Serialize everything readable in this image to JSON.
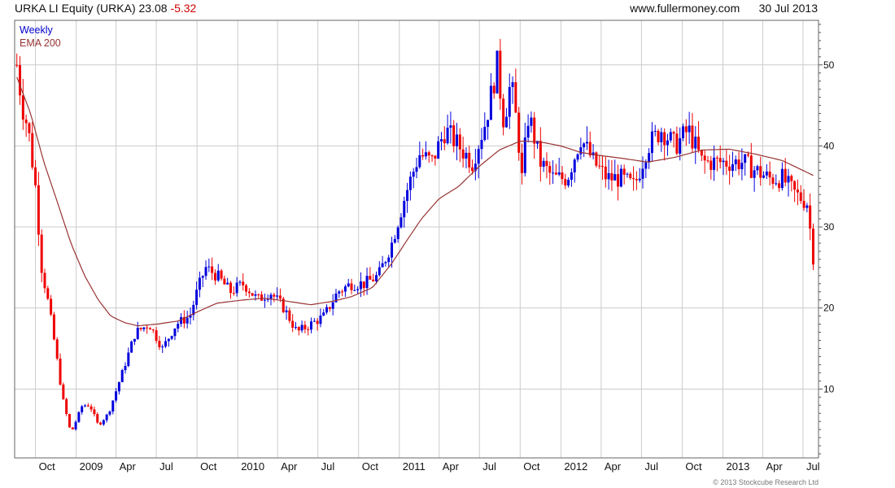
{
  "header": {
    "symbol": "URKA LI Equity (URKA)",
    "price": "23.08",
    "change": "-5.32",
    "website": "www.fullermoney.com",
    "date": "30 Jul 2013"
  },
  "legend": {
    "frequency": "Weekly",
    "ema": "EMA 200"
  },
  "copyright": "© 2013 Stockcube Research Ltd",
  "colors": {
    "up": "#0000dd",
    "down": "#ee0000",
    "ema": "#993333",
    "grid": "#cccccc",
    "frame": "#666666"
  },
  "chart_data": {
    "type": "candlestick",
    "frequency": "Weekly",
    "y_axis": {
      "position": "right",
      "ticks": [
        10,
        20,
        30,
        40,
        50
      ],
      "range": [
        1.5,
        55.5
      ]
    },
    "x_ticks": [
      {
        "label": "Oct",
        "date": "2008-10"
      },
      {
        "label": "2009",
        "date": "2009-01"
      },
      {
        "label": "Apr",
        "date": "2009-04"
      },
      {
        "label": "Jul",
        "date": "2009-07"
      },
      {
        "label": "Oct",
        "date": "2009-10"
      },
      {
        "label": "2010",
        "date": "2010-01"
      },
      {
        "label": "Apr",
        "date": "2010-04"
      },
      {
        "label": "Jul",
        "date": "2010-07"
      },
      {
        "label": "Oct",
        "date": "2010-10"
      },
      {
        "label": "2011",
        "date": "2011-01"
      },
      {
        "label": "Apr",
        "date": "2011-04"
      },
      {
        "label": "Jul",
        "date": "2011-07"
      },
      {
        "label": "Oct",
        "date": "2011-10"
      },
      {
        "label": "2012",
        "date": "2012-01"
      },
      {
        "label": "Apr",
        "date": "2012-04"
      },
      {
        "label": "Jul",
        "date": "2012-07"
      },
      {
        "label": "Oct",
        "date": "2012-10"
      },
      {
        "label": "2013",
        "date": "2013-01"
      },
      {
        "label": "Apr",
        "date": "2013-04"
      },
      {
        "label": "Jul",
        "date": "2013-07"
      }
    ],
    "price_anchors": [
      [
        "2008-08-20",
        50
      ],
      [
        "2008-09-01",
        45
      ],
      [
        "2008-09-15",
        42
      ],
      [
        "2008-10-01",
        35
      ],
      [
        "2008-10-15",
        25
      ],
      [
        "2008-11-01",
        20
      ],
      [
        "2008-11-15",
        15
      ],
      [
        "2008-12-01",
        9
      ],
      [
        "2008-12-20",
        4.5
      ],
      [
        "2009-01-15",
        8
      ],
      [
        "2009-02-01",
        8
      ],
      [
        "2009-02-20",
        5.5
      ],
      [
        "2009-03-15",
        7
      ],
      [
        "2009-04-15",
        12
      ],
      [
        "2009-05-15",
        17
      ],
      [
        "2009-06-15",
        18
      ],
      [
        "2009-07-15",
        15
      ],
      [
        "2009-08-15",
        18
      ],
      [
        "2009-09-15",
        19
      ],
      [
        "2009-10-01",
        22
      ],
      [
        "2009-10-20",
        25
      ],
      [
        "2009-11-15",
        24
      ],
      [
        "2009-12-15",
        22
      ],
      [
        "2010-01-15",
        23
      ],
      [
        "2010-02-15",
        21
      ],
      [
        "2010-03-15",
        22
      ],
      [
        "2010-04-15",
        20
      ],
      [
        "2010-05-15",
        17
      ],
      [
        "2010-06-15",
        18
      ],
      [
        "2010-07-15",
        19
      ],
      [
        "2010-08-15",
        22
      ],
      [
        "2010-09-15",
        23
      ],
      [
        "2010-10-15",
        23
      ],
      [
        "2010-11-15",
        24
      ],
      [
        "2010-12-15",
        28
      ],
      [
        "2011-01-15",
        34
      ],
      [
        "2011-02-15",
        39
      ],
      [
        "2011-03-15",
        38
      ],
      [
        "2011-04-15",
        42
      ],
      [
        "2011-05-15",
        40
      ],
      [
        "2011-06-15",
        38
      ],
      [
        "2011-07-15",
        43
      ],
      [
        "2011-08-10",
        50
      ],
      [
        "2011-08-25",
        43
      ],
      [
        "2011-09-10",
        48
      ],
      [
        "2011-09-25",
        42
      ],
      [
        "2011-10-05",
        36
      ],
      [
        "2011-10-20",
        44
      ],
      [
        "2011-11-15",
        38
      ],
      [
        "2011-12-15",
        36
      ],
      [
        "2012-01-15",
        36
      ],
      [
        "2012-02-15",
        41
      ],
      [
        "2012-03-15",
        38
      ],
      [
        "2012-04-15",
        36
      ],
      [
        "2012-05-15",
        36
      ],
      [
        "2012-06-15",
        35
      ],
      [
        "2012-07-15",
        40
      ],
      [
        "2012-08-15",
        42
      ],
      [
        "2012-09-15",
        40
      ],
      [
        "2012-10-15",
        42
      ],
      [
        "2012-11-15",
        38
      ],
      [
        "2012-12-15",
        38
      ],
      [
        "2013-01-15",
        38
      ],
      [
        "2013-02-15",
        38
      ],
      [
        "2013-03-15",
        37
      ],
      [
        "2013-04-15",
        36
      ],
      [
        "2013-05-15",
        36
      ],
      [
        "2013-06-15",
        34
      ],
      [
        "2013-07-10",
        33
      ],
      [
        "2013-07-20",
        28.4
      ],
      [
        "2013-07-30",
        23.08
      ]
    ],
    "ema_anchors": [
      [
        "2008-08-20",
        48.5
      ],
      [
        "2008-09-20",
        44
      ],
      [
        "2008-10-20",
        38
      ],
      [
        "2008-11-20",
        33
      ],
      [
        "2008-12-20",
        28
      ],
      [
        "2009-01-20",
        24
      ],
      [
        "2009-02-20",
        21
      ],
      [
        "2009-03-20",
        19
      ],
      [
        "2009-04-20",
        18.2
      ],
      [
        "2009-05-20",
        17.8
      ],
      [
        "2009-07-01",
        18
      ],
      [
        "2009-08-20",
        18.4
      ],
      [
        "2009-10-01",
        19.5
      ],
      [
        "2009-11-15",
        20.6
      ],
      [
        "2010-01-15",
        21
      ],
      [
        "2010-03-01",
        21.2
      ],
      [
        "2010-04-15",
        20.9
      ],
      [
        "2010-06-15",
        20.4
      ],
      [
        "2010-08-01",
        20.8
      ],
      [
        "2010-09-15",
        21.4
      ],
      [
        "2010-11-01",
        22.5
      ],
      [
        "2010-12-15",
        25.5
      ],
      [
        "2011-01-20",
        28.5
      ],
      [
        "2011-02-20",
        31
      ],
      [
        "2011-04-01",
        33.5
      ],
      [
        "2011-05-15",
        35
      ],
      [
        "2011-07-01",
        37.5
      ],
      [
        "2011-08-15",
        39.5
      ],
      [
        "2011-10-01",
        40.6
      ],
      [
        "2011-11-15",
        40.5
      ],
      [
        "2012-01-01",
        40
      ],
      [
        "2012-02-15",
        39.2
      ],
      [
        "2012-04-01",
        38.8
      ],
      [
        "2012-05-15",
        38.5
      ],
      [
        "2012-07-15",
        38
      ],
      [
        "2012-09-15",
        38.6
      ],
      [
        "2012-11-15",
        39.5
      ],
      [
        "2013-01-15",
        39.6
      ],
      [
        "2013-03-15",
        39
      ],
      [
        "2013-05-15",
        38.2
      ],
      [
        "2013-06-15",
        37.4
      ],
      [
        "2013-07-30",
        36.2
      ]
    ]
  }
}
